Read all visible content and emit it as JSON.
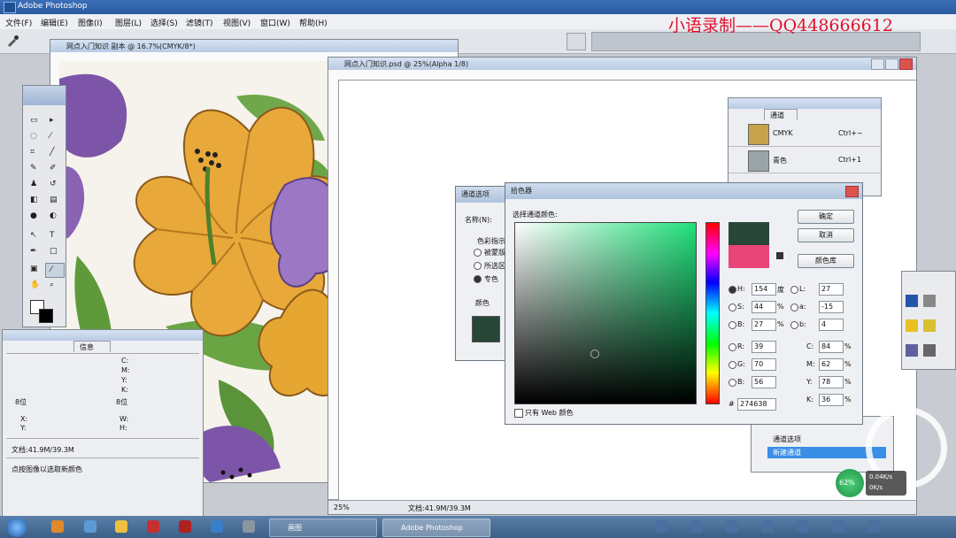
{
  "app": {
    "title": "Adobe Photoshop"
  },
  "watermark": "小语录制——QQ448666612",
  "menu": [
    "文件(F)",
    "编辑(E)",
    "图像(I)",
    "图层(L)",
    "选择(S)",
    "滤镜(T)",
    "视图(V)",
    "窗口(W)",
    "帮助(H)"
  ],
  "doc1": {
    "title": "网点入门知识 副本 @ 16.7%(CMYK/8*)"
  },
  "doc2": {
    "title": "网点入门知识.psd @ 25%(Alpha 1/8)",
    "zoom": "25%",
    "status": "文档:41.9M/39.3M"
  },
  "info_panel": {
    "tab": "信息",
    "cmyk_labels": [
      "C:",
      "M:",
      "Y:",
      "K:"
    ],
    "bits_left": "8位",
    "bits_right": "8位",
    "x_label": "X:",
    "y_label": "Y:",
    "w_label": "W:",
    "h_label": "H:",
    "doc_info": "文档:41.9M/39.3M",
    "hint": "点按图像以选取新颜色"
  },
  "channels_panel": {
    "tab": "通道",
    "items": [
      {
        "name": "CMYK",
        "shortcut": "Ctrl+~"
      },
      {
        "name": "青色",
        "shortcut": "Ctrl+1"
      }
    ],
    "bottom_items": [
      "通道选项",
      "新建通道"
    ]
  },
  "new_channel_dialog": {
    "title": "通道选项",
    "name_label": "名称(N):",
    "color_indicates": "色彩指示",
    "options": [
      "被蒙版区域",
      "所选区域",
      "专色"
    ],
    "color_label": "颜色"
  },
  "color_picker": {
    "title": "拾色器",
    "prompt": "选择通道颜色:",
    "buttons": {
      "ok": "确定",
      "cancel": "取消",
      "libraries": "颜色库"
    },
    "fields": {
      "H": "154",
      "S": "44",
      "B": "27",
      "R": "39",
      "G": "70",
      "Bb": "56",
      "L": "27",
      "a": "-15",
      "b": "4",
      "C": "84",
      "M": "62",
      "Y": "78",
      "K": "36",
      "hex": "274638"
    },
    "units": {
      "deg": "度",
      "pct": "%"
    },
    "web_only": "只有 Web 颜色",
    "new_color": "#274638",
    "old_color": "#e8457a"
  },
  "taskbar": {
    "tasks": [
      "画图",
      "Adobe Photoshop"
    ],
    "tray_percent": "62%",
    "tray_up": "0.04K/s",
    "tray_down": "0K/s"
  }
}
